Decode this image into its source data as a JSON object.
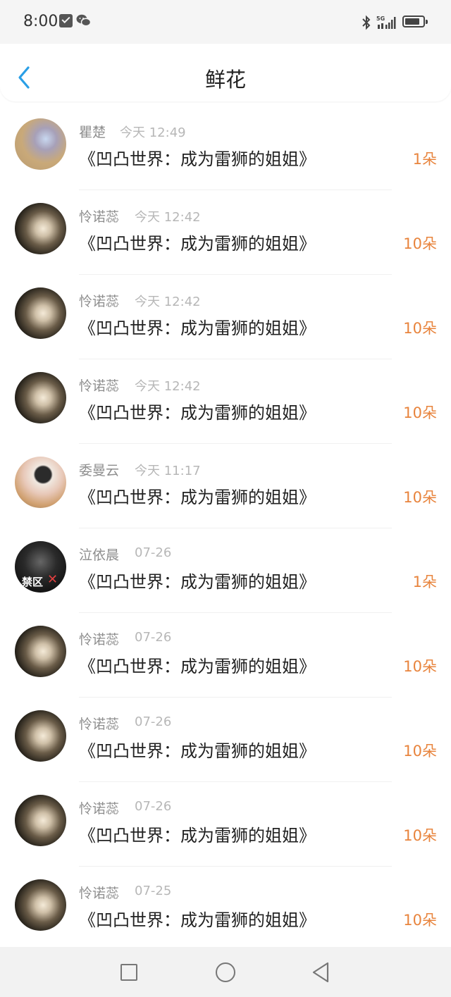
{
  "status_bar": {
    "time": "8:00",
    "icons": [
      "mail-icon",
      "wechat-icon",
      "bluetooth-icon",
      "signal-5g-icon",
      "battery-icon"
    ]
  },
  "header": {
    "title": "鲜花",
    "back_icon": "chevron-left-icon",
    "accent_color": "#2a9fe6"
  },
  "colors": {
    "count": "#e8843d",
    "username": "#8e8e8e",
    "timestamp": "#b7b7b7"
  },
  "items": [
    {
      "username": "瞿楚",
      "time": "今天 12:49",
      "title": "《凹凸世界：成为雷狮的姐姐》",
      "count": "1朵",
      "avatar": "avatar-1"
    },
    {
      "username": "怜诺蕊",
      "time": "今天 12:42",
      "title": "《凹凸世界：成为雷狮的姐姐》",
      "count": "10朵",
      "avatar": "avatar-2"
    },
    {
      "username": "怜诺蕊",
      "time": "今天 12:42",
      "title": "《凹凸世界：成为雷狮的姐姐》",
      "count": "10朵",
      "avatar": "avatar-2"
    },
    {
      "username": "怜诺蕊",
      "time": "今天 12:42",
      "title": "《凹凸世界：成为雷狮的姐姐》",
      "count": "10朵",
      "avatar": "avatar-2"
    },
    {
      "username": "委曼云",
      "time": "今天 11:17",
      "title": "《凹凸世界：成为雷狮的姐姐》",
      "count": "10朵",
      "avatar": "avatar-3"
    },
    {
      "username": "泣依晨",
      "time": "07-26",
      "title": "《凹凸世界：成为雷狮的姐姐》",
      "count": "1朵",
      "avatar": "avatar-4",
      "badge": "禁区"
    },
    {
      "username": "怜诺蕊",
      "time": "07-26",
      "title": "《凹凸世界：成为雷狮的姐姐》",
      "count": "10朵",
      "avatar": "avatar-2"
    },
    {
      "username": "怜诺蕊",
      "time": "07-26",
      "title": "《凹凸世界：成为雷狮的姐姐》",
      "count": "10朵",
      "avatar": "avatar-2"
    },
    {
      "username": "怜诺蕊",
      "time": "07-26",
      "title": "《凹凸世界：成为雷狮的姐姐》",
      "count": "10朵",
      "avatar": "avatar-2"
    },
    {
      "username": "怜诺蕊",
      "time": "07-25",
      "title": "《凹凸世界：成为雷狮的姐姐》",
      "count": "10朵",
      "avatar": "avatar-2"
    }
  ],
  "nav_bar": {
    "icons": [
      "recent-apps-icon",
      "home-icon",
      "back-triangle-icon"
    ]
  }
}
